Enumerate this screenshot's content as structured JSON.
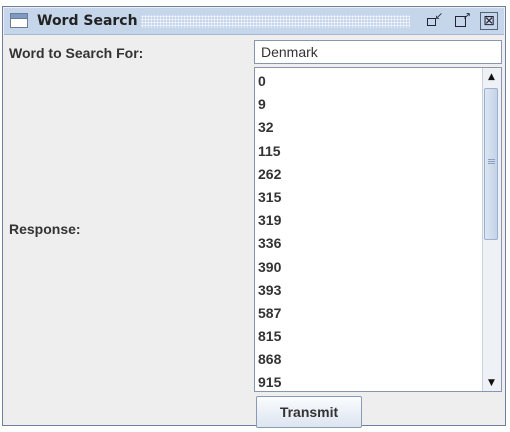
{
  "window": {
    "title": "Word Search",
    "controls": {
      "minimize_icon": "iconify-icon",
      "maximize_icon": "maximize-icon",
      "close_icon": "close-icon",
      "close_glyph": "⊠"
    }
  },
  "form": {
    "word_label": "Word to Search For:",
    "word_value": "Denmark",
    "response_label": "Response:",
    "response_items": [
      "0",
      "9",
      "32",
      "115",
      "262",
      "315",
      "319",
      "336",
      "390",
      "393",
      "587",
      "815",
      "868",
      "915"
    ],
    "transmit_label": "Transmit"
  },
  "colors": {
    "titlebar": "#c5d5ea",
    "window_bg": "#eeeeee",
    "border": "#8796ad"
  }
}
